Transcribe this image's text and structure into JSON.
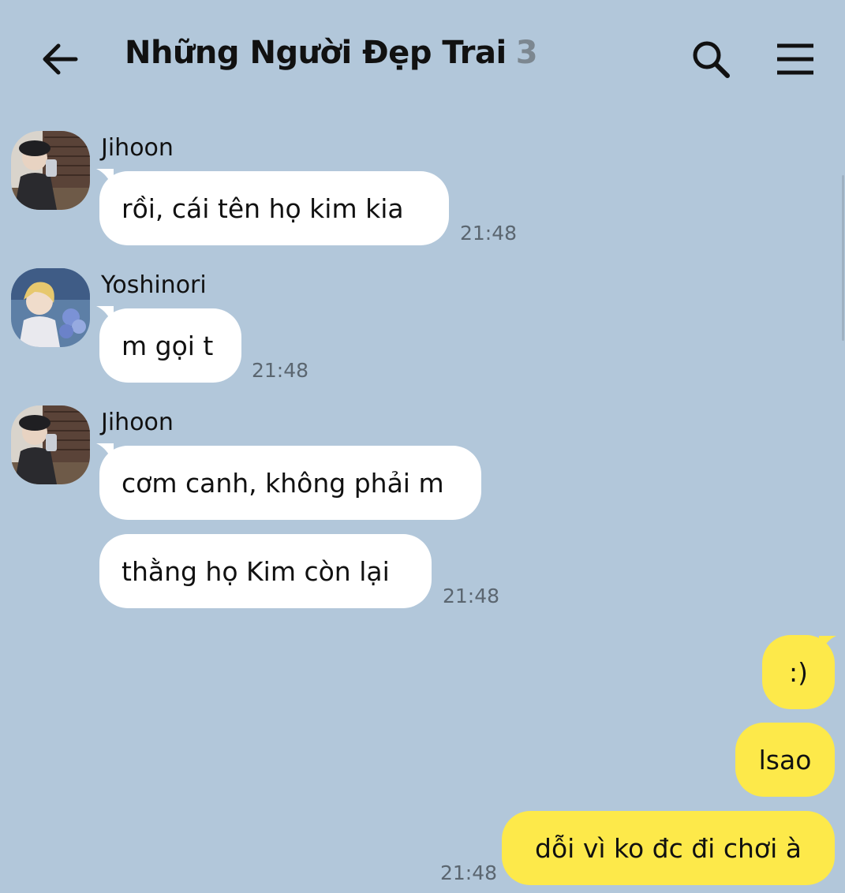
{
  "header": {
    "title": "Những Người Đẹp Trai",
    "member_count": "3",
    "back_icon": "arrow-left-icon",
    "search_icon": "search-icon",
    "menu_icon": "menu-icon"
  },
  "colors": {
    "background": "#b2c7da",
    "incoming_bubble": "#ffffff",
    "outgoing_bubble": "#fde94a",
    "timestamp": "#5b6670"
  },
  "messages": [
    {
      "sender": "Jihoon",
      "text": "rồi, cái tên họ kim kia",
      "time": "21:48"
    },
    {
      "sender": "Yoshinori",
      "text": "m gọi t",
      "time": "21:48"
    },
    {
      "sender": "Jihoon",
      "text": "cơm canh, không phải m"
    },
    {
      "text": "thằng họ Kim còn lại",
      "time": "21:48"
    }
  ],
  "outgoing": [
    {
      "text": ":)"
    },
    {
      "text": "lsao"
    },
    {
      "text": "dỗi vì ko đc đi chơi à",
      "time": "21:48"
    }
  ]
}
